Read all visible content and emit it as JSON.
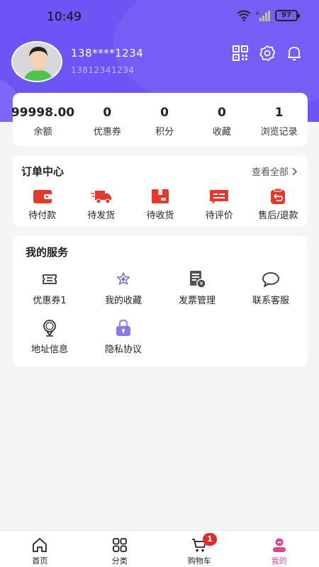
{
  "status_bar": {
    "time": "10:49",
    "battery": "97"
  },
  "profile": {
    "phone_masked": "138****1234",
    "phone_full": "13812341234"
  },
  "header_icons": [
    "qr-code-icon",
    "settings-icon",
    "bell-icon"
  ],
  "stats": [
    {
      "value": "99998.00",
      "label": "余额"
    },
    {
      "value": "0",
      "label": "优惠券"
    },
    {
      "value": "0",
      "label": "积分"
    },
    {
      "value": "0",
      "label": "收藏"
    },
    {
      "value": "1",
      "label": "浏览记录"
    }
  ],
  "orders": {
    "title": "订单中心",
    "view_all": "查看全部",
    "items": [
      {
        "label": "待付款",
        "icon": "wallet-icon"
      },
      {
        "label": "待发货",
        "icon": "truck-icon"
      },
      {
        "label": "待收货",
        "icon": "package-icon"
      },
      {
        "label": "待评价",
        "icon": "review-icon"
      },
      {
        "label": "售后/退款",
        "icon": "refund-icon"
      }
    ]
  },
  "services": {
    "title": "我的服务",
    "items": [
      {
        "label": "优惠券1",
        "icon": "coupon-icon"
      },
      {
        "label": "我的收藏",
        "icon": "star-icon"
      },
      {
        "label": "发票管理",
        "icon": "invoice-icon"
      },
      {
        "label": "联系客服",
        "icon": "chat-icon"
      },
      {
        "label": "地址信息",
        "icon": "location-icon"
      },
      {
        "label": "隐私协议",
        "icon": "lock-icon"
      }
    ]
  },
  "tabbar": {
    "tabs": [
      {
        "label": "首页",
        "icon": "home-icon"
      },
      {
        "label": "分类",
        "icon": "category-icon"
      },
      {
        "label": "购物车",
        "icon": "cart-icon",
        "badge": "1"
      },
      {
        "label": "我的",
        "icon": "profile-icon",
        "active": true
      }
    ]
  },
  "colors": {
    "header": "#6c54f5",
    "order_icon": "#e23a2e",
    "active_tab": "#e04490",
    "badge": "#e52a2a"
  }
}
